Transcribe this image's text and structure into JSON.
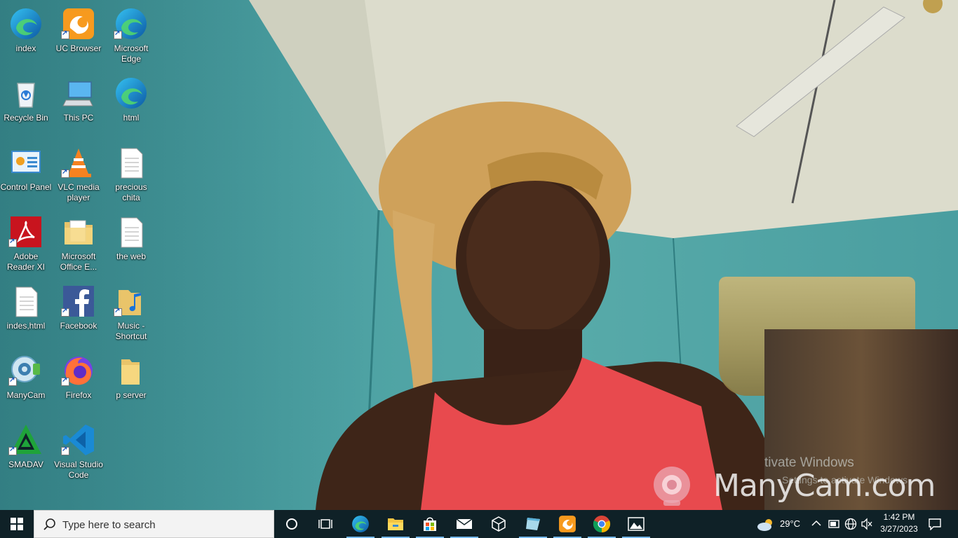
{
  "desktop": {
    "icons": [
      {
        "label": "index",
        "icon": "edge-icon"
      },
      {
        "label": "UC Browser",
        "icon": "uc-browser-icon"
      },
      {
        "label": "Microsoft Edge",
        "icon": "edge-icon"
      },
      {
        "label": "Recycle Bin",
        "icon": "recycle-bin-icon"
      },
      {
        "label": "This PC",
        "icon": "this-pc-icon"
      },
      {
        "label": "html",
        "icon": "edge-icon"
      },
      {
        "label": "Control Panel",
        "icon": "control-panel-icon"
      },
      {
        "label": "VLC media player",
        "icon": "vlc-icon"
      },
      {
        "label": "precious chita",
        "icon": "document-icon"
      },
      {
        "label": "Adobe Reader XI",
        "icon": "adobe-reader-icon"
      },
      {
        "label": "Microsoft Office E...",
        "icon": "folder-icon"
      },
      {
        "label": "the web",
        "icon": "document-icon"
      },
      {
        "label": "indes,html",
        "icon": "document-icon"
      },
      {
        "label": "Facebook",
        "icon": "facebook-icon"
      },
      {
        "label": "Music - Shortcut",
        "icon": "music-folder-icon"
      },
      {
        "label": "ManyCam",
        "icon": "manycam-icon"
      },
      {
        "label": "Firefox",
        "icon": "firefox-icon"
      },
      {
        "label": "p server",
        "icon": "folder-icon"
      },
      {
        "label": "SMADAV",
        "icon": "smadav-icon"
      },
      {
        "label": "Visual Studio Code",
        "icon": "vscode-icon"
      }
    ],
    "watermark": {
      "activate_line1": "tivate Windows",
      "activate_line2": "Settings to activate Windows",
      "manycam": "ManyCam.com"
    }
  },
  "taskbar": {
    "search_placeholder": "Type here to search",
    "pinned": [
      "cortana-icon",
      "task-view-icon",
      "edge-icon",
      "file-explorer-icon",
      "store-icon",
      "mail-icon",
      "3d-viewer-icon",
      "notepad-icon",
      "uc-browser-icon",
      "chrome-icon",
      "photos-icon"
    ],
    "weather": "29°C",
    "time": "1:42 PM",
    "date": "3/27/2023"
  }
}
